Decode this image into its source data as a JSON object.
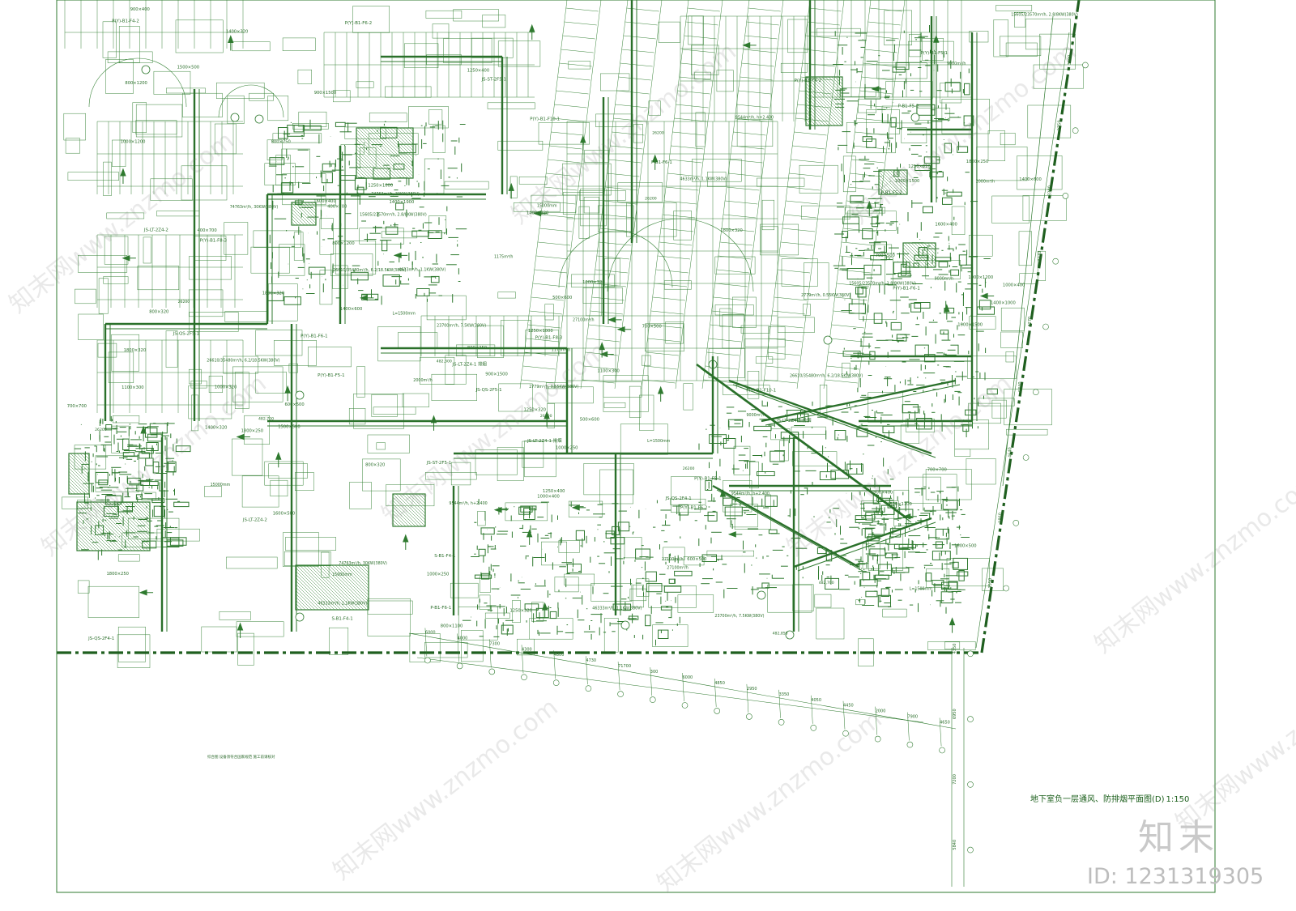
{
  "drawing": {
    "title": "地下室负一层通风、防排烟平面图(D)",
    "scale": "1:150",
    "note": "综合图 设备须符合国家规范 施工前请核对"
  },
  "colors": {
    "line": "#2f7a2f",
    "thick": "#1f5f1f",
    "background": "#ffffff",
    "watermark": "#bdbdbd"
  },
  "watermark": {
    "logo": "知末",
    "id": "ID: 1231319305",
    "site": "知末网www.znzmo.com"
  },
  "duct_labels": [
    "1800×250",
    "1800×320",
    "1400×320",
    "1250×320",
    "1000×320",
    "800×250",
    "1000×250",
    "1600×400",
    "800×320",
    "1250×400",
    "1000×400",
    "1600×500",
    "1250×1000",
    "1400×1000",
    "900×1500",
    "1000×1500",
    "700×700",
    "1500×500",
    "400×700",
    "800×1200",
    "1000×1200",
    "1400×600",
    "800×1100",
    "900×400",
    "600×500",
    "500×600",
    "1100×300",
    "700×500"
  ],
  "fan_labels": [
    "JS-LT-2Z4-1 排烟",
    "P(Y)-B1-F5-1",
    "P(Y)-B1-F4-2",
    "P(Y)-B1-F6-1",
    "P(Y)-B1-F6-2",
    "P(Y)-B1-F8-3",
    "P(Y)-B1-F10-1",
    "P-B1-F5-2",
    "P-B1-F6-1",
    "JS-QS-2F4-1",
    "JS-QS-2F5-1",
    "JS-LT-2Z4-2",
    "S-B1-F4-1",
    "JS-ST-2F5-1"
  ],
  "flow_labels": [
    "27100m³/h",
    "9000m³/h",
    "15000mm",
    "L=1500mm",
    "74763m³/h, 30KW(380V)",
    "26610/35480m³/h, 6.2/18.5KW(380V)",
    "9544m³/h, h+2.400",
    "15605/23570m³/h, 2.8/8KW(380V)",
    "46333m³/h, 1.1KW(380V)",
    "1175m³/h",
    "4633m³/h, 1.1KW(380V)",
    "2779m³/h, 0.55KW(380V)",
    "23700m³/h, 7.5KW(380V)",
    "2000m³/h"
  ],
  "dims_bottom": [
    "6000",
    "4000",
    "7300",
    "4300",
    "4800",
    "4730",
    "71700",
    "300",
    "6000",
    "4850",
    "2950",
    "3350",
    "4050",
    "4450",
    "2000",
    "7900",
    "4650"
  ],
  "dims_right": [
    "3300",
    "3750",
    "3300",
    "4270",
    "4270",
    "6340",
    "4640",
    "1860",
    "3550",
    "4350",
    "6950",
    "7200",
    "5840"
  ],
  "room_dims": [
    "26200",
    "26200",
    "26200",
    "482,700",
    "482,300",
    "482,850"
  ]
}
